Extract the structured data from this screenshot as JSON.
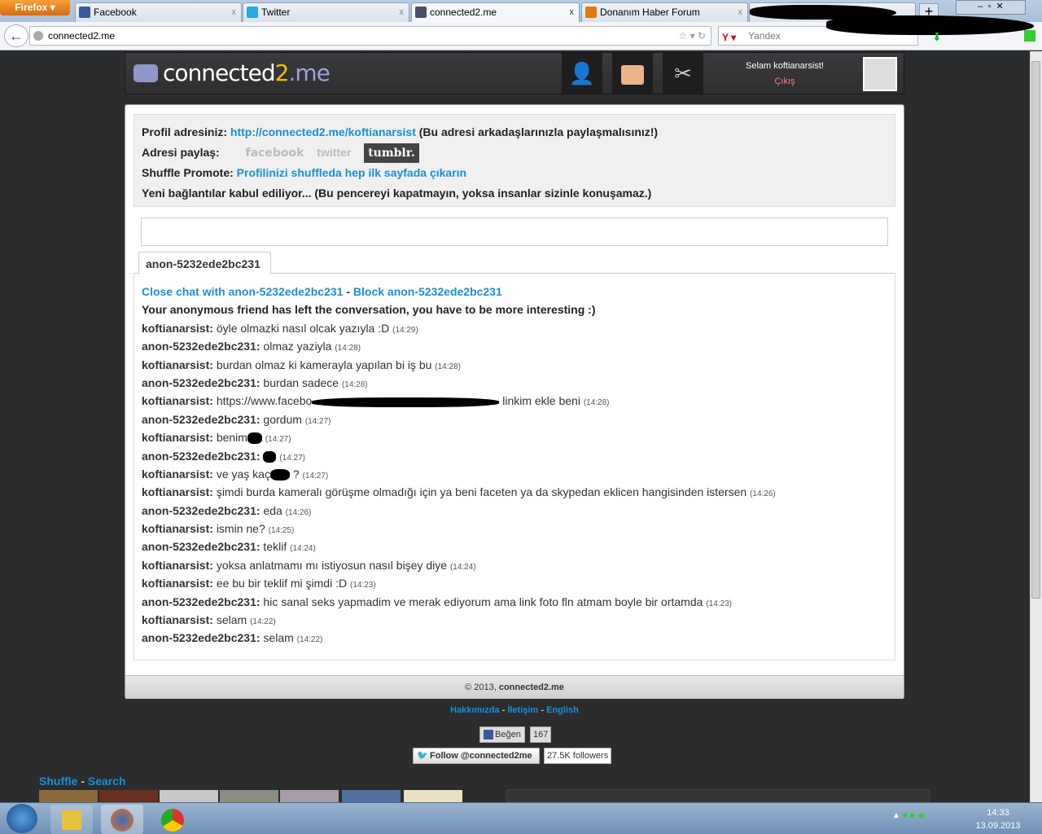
{
  "browser": {
    "menu_label": "Firefox",
    "tabs": [
      {
        "label": "Facebook",
        "icon": "facebook-icon",
        "color": "#3b5998"
      },
      {
        "label": "Twitter",
        "icon": "twitter-icon",
        "color": "#2aa9e0"
      },
      {
        "label": "connected2.me",
        "icon": "connected2me-icon",
        "color": "#4a4f6a"
      },
      {
        "label": "Donanım Haber Forum",
        "icon": "dh-icon",
        "color": "#e07a10"
      }
    ],
    "url": "connected2.me",
    "search_placeholder": "Yandex"
  },
  "header": {
    "logo_main": "connected",
    "logo_two": "2",
    "logo_me": ".me",
    "greeting": "Selam koftianarsist!",
    "logout": "Çıkış"
  },
  "info": {
    "profile_label": "Profil adresiniz:",
    "profile_url": "http://connected2.me/koftianarsist",
    "profile_note": "(Bu adresi arkadaşlarınızla paylaşmalısınız!)",
    "share_label": "Adresi paylaş:",
    "share_buttons": [
      "facebook",
      "twitter",
      "tumblr."
    ],
    "shuffle_label": "Shuffle Promote:",
    "shuffle_link": "Profilinizi shuffleda hep ilk sayfada çıkarın",
    "status": "Yeni bağlantılar kabul ediliyor... (Bu pencereyi kapatmayın, yoksa insanlar sizinle konuşamaz.)"
  },
  "chat": {
    "tab": "anon-5232ede2bc231",
    "close_link": "Close chat with anon-5232ede2bc231",
    "sep": " - ",
    "block_link": "Block anon-5232ede2bc231",
    "notice": "Your anonymous friend has left the conversation, you have to be more interesting :)",
    "messages": [
      {
        "user": "koftianarsist:",
        "text": "öyle olmazki nasıl olcak yazıyla :D",
        "time": "(14:29)"
      },
      {
        "user": "anon-5232ede2bc231:",
        "text": "olmaz yaziyla",
        "time": "(14:28)"
      },
      {
        "user": "koftianarsist:",
        "text": "burdan olmaz ki kamerayla yapılan bi iş bu",
        "time": "(14:28)"
      },
      {
        "user": "anon-5232ede2bc231:",
        "text": "burdan sadece",
        "time": "(14:28)"
      },
      {
        "user": "koftianarsist:",
        "text": "https://www.facebo",
        "redacted": 230,
        "after": "linkim ekle beni",
        "time": "(14:28)"
      },
      {
        "user": "anon-5232ede2bc231:",
        "text": "gordum",
        "time": "(14:27)"
      },
      {
        "user": "koftianarsist:",
        "text": "benim",
        "redacted": 18,
        "after": "",
        "time": "(14:27)"
      },
      {
        "user": "anon-5232ede2bc231:",
        "text": "",
        "redacted": 16,
        "after": "",
        "time": "(14:27)"
      },
      {
        "user": "koftianarsist:",
        "text": "ve yaş kaç",
        "redacted": 24,
        "after": "?",
        "time": "(14:27)"
      },
      {
        "user": "koftianarsist:",
        "text": "şimdi burda kameralı görüşme olmadığı için ya beni faceten ya da skypedan eklicen hangisinden istersen",
        "time": "(14:26)"
      },
      {
        "user": "anon-5232ede2bc231:",
        "text": "eda",
        "time": "(14:26)"
      },
      {
        "user": "koftianarsist:",
        "text": "ismin ne?",
        "time": "(14:25)"
      },
      {
        "user": "anon-5232ede2bc231:",
        "text": "teklif",
        "time": "(14:24)"
      },
      {
        "user": "koftianarsist:",
        "text": "yoksa anlatmamı mı istiyosun nasıl bişey diye",
        "time": "(14:24)"
      },
      {
        "user": "koftianarsist:",
        "text": "ee bu bir teklif mi şimdi :D",
        "time": "(14:23)"
      },
      {
        "user": "anon-5232ede2bc231:",
        "text": "hic sanal seks yapmadim ve merak ediyorum ama link foto fln atmam boyle bir ortamda",
        "time": "(14:23)"
      },
      {
        "user": "koftianarsist:",
        "text": "selam",
        "time": "(14:22)"
      },
      {
        "user": "anon-5232ede2bc231:",
        "text": "selam",
        "time": "(14:22)"
      }
    ]
  },
  "footer": {
    "copyright": "© 2013, ",
    "site": "connected2.me"
  },
  "links": {
    "about": "Hakkımızda",
    "contact": "İletişim",
    "english": "English",
    "sep": " - "
  },
  "social": {
    "like": "Beğen",
    "like_count": "167",
    "follow": "Follow @connected2me",
    "followers": "27.5K followers"
  },
  "shuffle": {
    "shuffle": "Shuffle",
    "sep": " - ",
    "search": "Search"
  },
  "taskbar": {
    "time": "14:33",
    "date": "13.09.2013"
  }
}
